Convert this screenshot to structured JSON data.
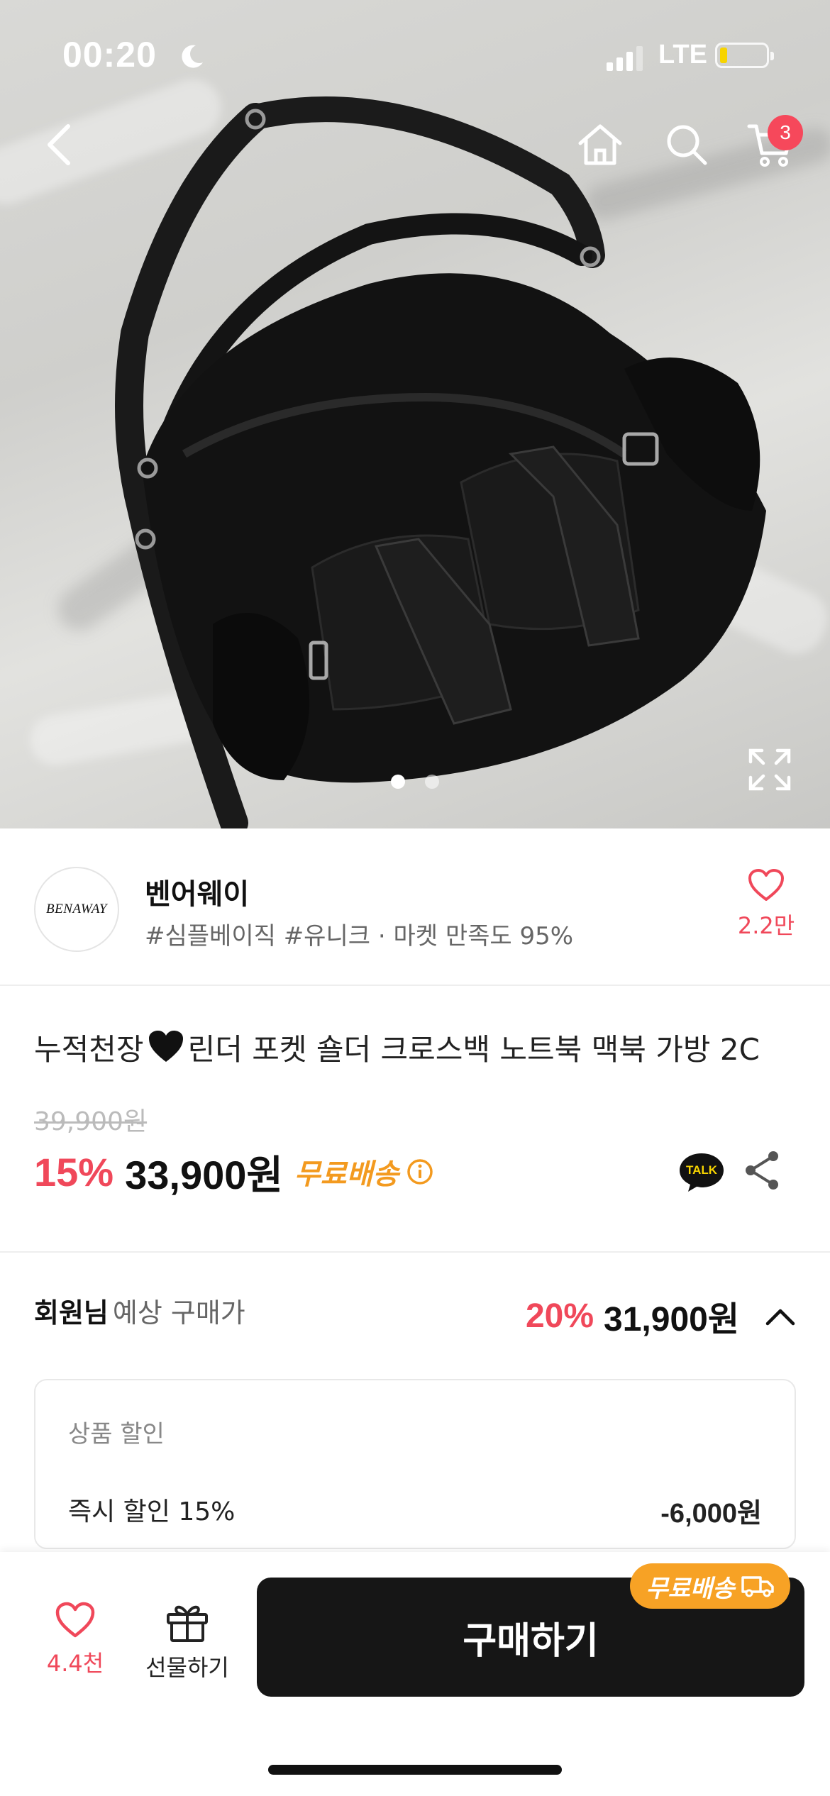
{
  "status_bar": {
    "time": "00:20",
    "network": "LTE"
  },
  "nav": {
    "cart_count": "3"
  },
  "gallery": {
    "image_description": "black nylon shoulder bag with strap pockets on white bedsheet",
    "total_images": 2,
    "current_index": 1
  },
  "shop": {
    "logo_text": "BENAWAY",
    "name": "벤어웨이",
    "tags": "#심플베이직 #유니크 · 마켓 만족도 95%",
    "favorite_count": "2.2만"
  },
  "product": {
    "title_prefix": "누적천장",
    "title_suffix": "린더 포켓 숄더 크로스백 노트북 맥북 가방 2C",
    "original_price": "39,900원",
    "discount_rate": "15%",
    "price": "33,900원",
    "shipping": "무료배송",
    "talk_label": "TALK"
  },
  "member_price": {
    "label_strong": "회원님",
    "label": "예상 구매가",
    "discount_rate": "20%",
    "price": "31,900원"
  },
  "discount_detail": {
    "header": "상품 할인",
    "row_label": "즉시 할인 15%",
    "row_value": "-6,000원"
  },
  "bottom_bar": {
    "like_count": "4.4천",
    "gift_label": "선물하기",
    "buy_label": "구매하기",
    "shipping_badge": "무료배송"
  },
  "colors": {
    "accent_red": "#f0485a",
    "shipping_orange": "#f39a1f",
    "buy_button": "#161616"
  }
}
